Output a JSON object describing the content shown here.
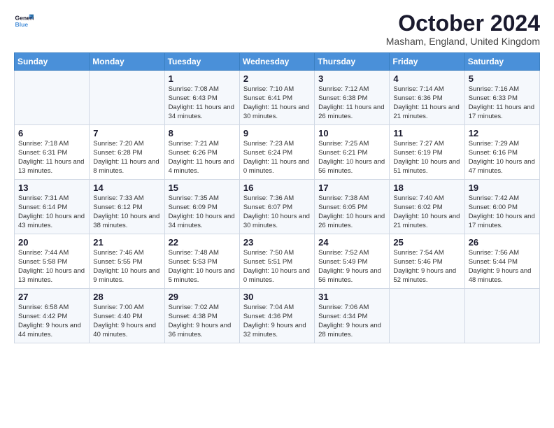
{
  "logo": {
    "line1": "General",
    "line2": "Blue"
  },
  "title": "October 2024",
  "subtitle": "Masham, England, United Kingdom",
  "days_of_week": [
    "Sunday",
    "Monday",
    "Tuesday",
    "Wednesday",
    "Thursday",
    "Friday",
    "Saturday"
  ],
  "weeks": [
    [
      {
        "day": "",
        "text": ""
      },
      {
        "day": "",
        "text": ""
      },
      {
        "day": "1",
        "text": "Sunrise: 7:08 AM\nSunset: 6:43 PM\nDaylight: 11 hours and 34 minutes."
      },
      {
        "day": "2",
        "text": "Sunrise: 7:10 AM\nSunset: 6:41 PM\nDaylight: 11 hours and 30 minutes."
      },
      {
        "day": "3",
        "text": "Sunrise: 7:12 AM\nSunset: 6:38 PM\nDaylight: 11 hours and 26 minutes."
      },
      {
        "day": "4",
        "text": "Sunrise: 7:14 AM\nSunset: 6:36 PM\nDaylight: 11 hours and 21 minutes."
      },
      {
        "day": "5",
        "text": "Sunrise: 7:16 AM\nSunset: 6:33 PM\nDaylight: 11 hours and 17 minutes."
      }
    ],
    [
      {
        "day": "6",
        "text": "Sunrise: 7:18 AM\nSunset: 6:31 PM\nDaylight: 11 hours and 13 minutes."
      },
      {
        "day": "7",
        "text": "Sunrise: 7:20 AM\nSunset: 6:28 PM\nDaylight: 11 hours and 8 minutes."
      },
      {
        "day": "8",
        "text": "Sunrise: 7:21 AM\nSunset: 6:26 PM\nDaylight: 11 hours and 4 minutes."
      },
      {
        "day": "9",
        "text": "Sunrise: 7:23 AM\nSunset: 6:24 PM\nDaylight: 11 hours and 0 minutes."
      },
      {
        "day": "10",
        "text": "Sunrise: 7:25 AM\nSunset: 6:21 PM\nDaylight: 10 hours and 56 minutes."
      },
      {
        "day": "11",
        "text": "Sunrise: 7:27 AM\nSunset: 6:19 PM\nDaylight: 10 hours and 51 minutes."
      },
      {
        "day": "12",
        "text": "Sunrise: 7:29 AM\nSunset: 6:16 PM\nDaylight: 10 hours and 47 minutes."
      }
    ],
    [
      {
        "day": "13",
        "text": "Sunrise: 7:31 AM\nSunset: 6:14 PM\nDaylight: 10 hours and 43 minutes."
      },
      {
        "day": "14",
        "text": "Sunrise: 7:33 AM\nSunset: 6:12 PM\nDaylight: 10 hours and 38 minutes."
      },
      {
        "day": "15",
        "text": "Sunrise: 7:35 AM\nSunset: 6:09 PM\nDaylight: 10 hours and 34 minutes."
      },
      {
        "day": "16",
        "text": "Sunrise: 7:36 AM\nSunset: 6:07 PM\nDaylight: 10 hours and 30 minutes."
      },
      {
        "day": "17",
        "text": "Sunrise: 7:38 AM\nSunset: 6:05 PM\nDaylight: 10 hours and 26 minutes."
      },
      {
        "day": "18",
        "text": "Sunrise: 7:40 AM\nSunset: 6:02 PM\nDaylight: 10 hours and 21 minutes."
      },
      {
        "day": "19",
        "text": "Sunrise: 7:42 AM\nSunset: 6:00 PM\nDaylight: 10 hours and 17 minutes."
      }
    ],
    [
      {
        "day": "20",
        "text": "Sunrise: 7:44 AM\nSunset: 5:58 PM\nDaylight: 10 hours and 13 minutes."
      },
      {
        "day": "21",
        "text": "Sunrise: 7:46 AM\nSunset: 5:55 PM\nDaylight: 10 hours and 9 minutes."
      },
      {
        "day": "22",
        "text": "Sunrise: 7:48 AM\nSunset: 5:53 PM\nDaylight: 10 hours and 5 minutes."
      },
      {
        "day": "23",
        "text": "Sunrise: 7:50 AM\nSunset: 5:51 PM\nDaylight: 10 hours and 0 minutes."
      },
      {
        "day": "24",
        "text": "Sunrise: 7:52 AM\nSunset: 5:49 PM\nDaylight: 9 hours and 56 minutes."
      },
      {
        "day": "25",
        "text": "Sunrise: 7:54 AM\nSunset: 5:46 PM\nDaylight: 9 hours and 52 minutes."
      },
      {
        "day": "26",
        "text": "Sunrise: 7:56 AM\nSunset: 5:44 PM\nDaylight: 9 hours and 48 minutes."
      }
    ],
    [
      {
        "day": "27",
        "text": "Sunrise: 6:58 AM\nSunset: 4:42 PM\nDaylight: 9 hours and 44 minutes."
      },
      {
        "day": "28",
        "text": "Sunrise: 7:00 AM\nSunset: 4:40 PM\nDaylight: 9 hours and 40 minutes."
      },
      {
        "day": "29",
        "text": "Sunrise: 7:02 AM\nSunset: 4:38 PM\nDaylight: 9 hours and 36 minutes."
      },
      {
        "day": "30",
        "text": "Sunrise: 7:04 AM\nSunset: 4:36 PM\nDaylight: 9 hours and 32 minutes."
      },
      {
        "day": "31",
        "text": "Sunrise: 7:06 AM\nSunset: 4:34 PM\nDaylight: 9 hours and 28 minutes."
      },
      {
        "day": "",
        "text": ""
      },
      {
        "day": "",
        "text": ""
      }
    ]
  ]
}
